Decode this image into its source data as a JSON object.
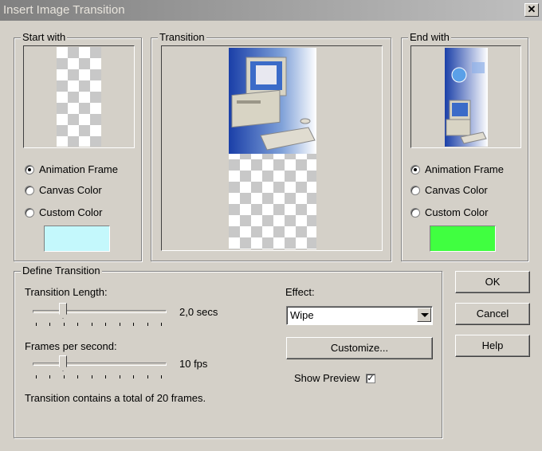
{
  "window": {
    "title": "Insert Image Transition",
    "close_glyph": "✕"
  },
  "start_with": {
    "label": "Start with",
    "options": [
      "Animation Frame",
      "Canvas Color",
      "Custom Color"
    ],
    "selected": 0,
    "custom_color": "#c4f8fc"
  },
  "transition": {
    "label": "Transition"
  },
  "end_with": {
    "label": "End with",
    "options": [
      "Animation Frame",
      "Canvas Color",
      "Custom Color"
    ],
    "selected": 0,
    "custom_color": "#40ff40"
  },
  "define": {
    "label": "Define Transition",
    "length_label": "Transition Length:",
    "length_value": "2,0 secs",
    "fps_label": "Frames per second:",
    "fps_value": "10 fps",
    "summary": "Transition contains a total of 20 frames.",
    "effect_label": "Effect:",
    "effect_value": "Wipe",
    "customize_label": "Customize...",
    "show_preview_label": "Show Preview",
    "show_preview_checked": true
  },
  "buttons": {
    "ok": "OK",
    "cancel": "Cancel",
    "help": "Help"
  },
  "icons": {
    "checkmark": "✓"
  }
}
